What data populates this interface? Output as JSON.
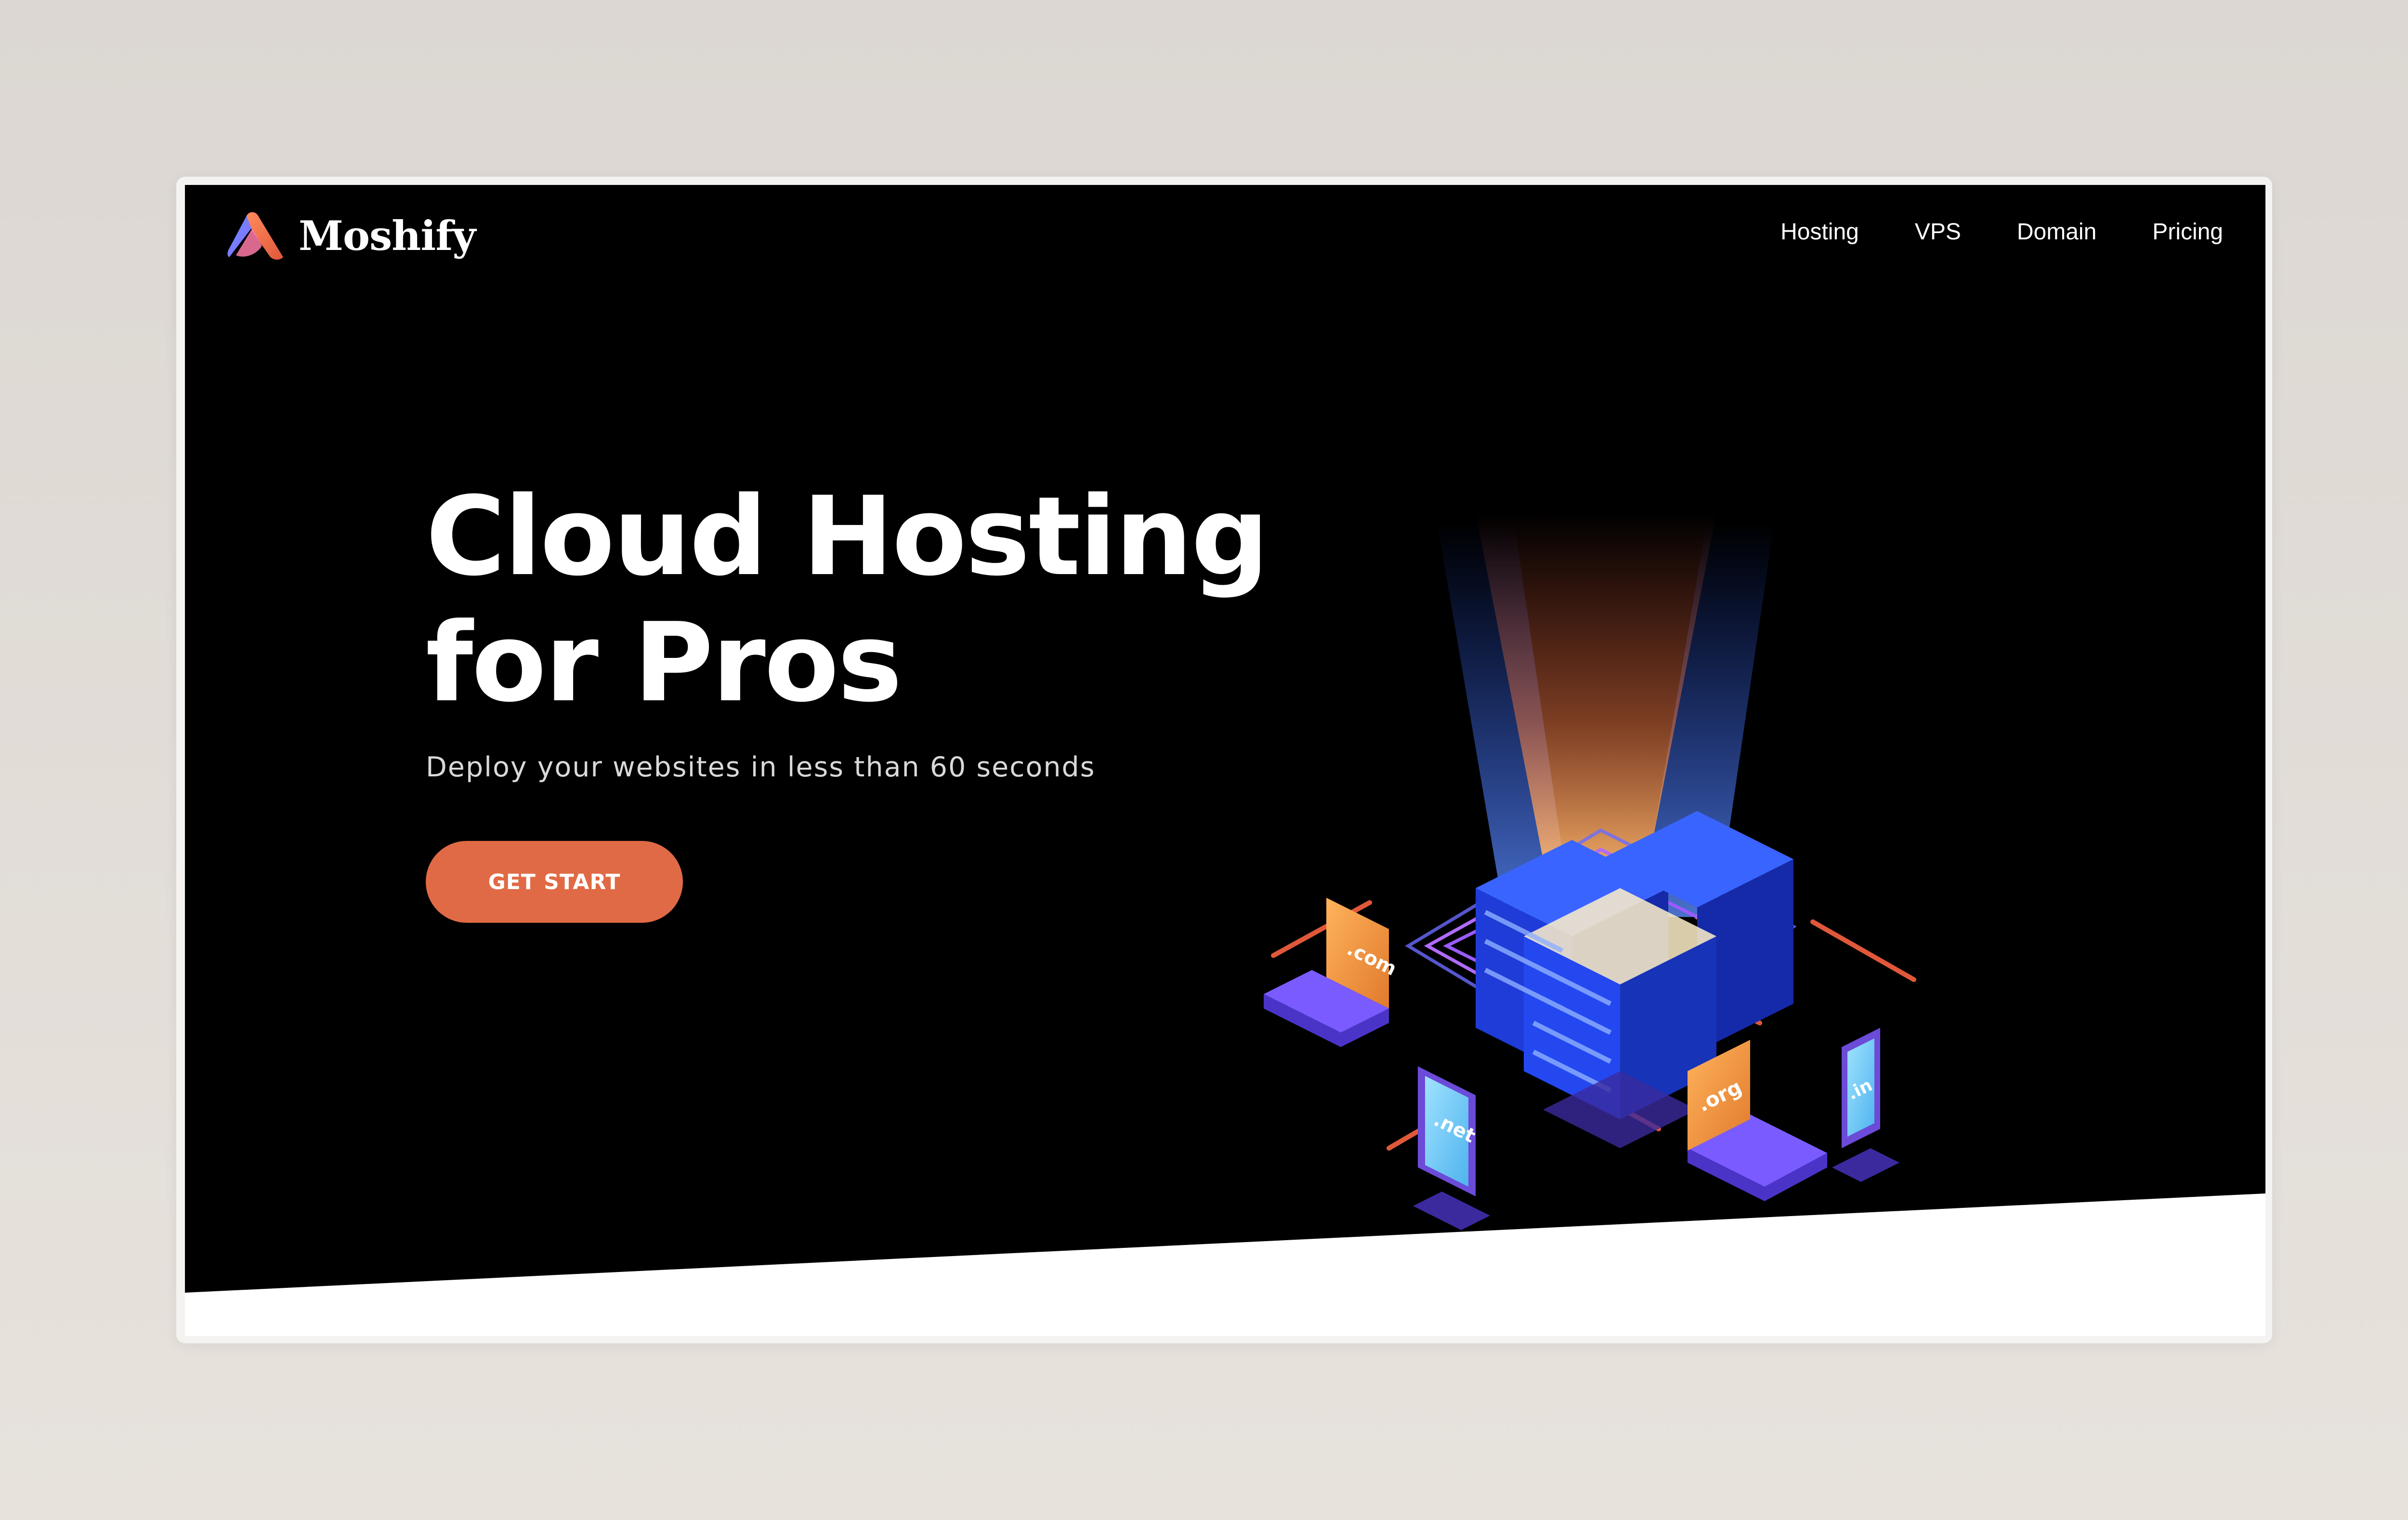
{
  "brand": {
    "name": "Moshify",
    "logo_icon": "moshify-logo-icon"
  },
  "nav": {
    "items": [
      {
        "label": "Hosting"
      },
      {
        "label": "VPS"
      },
      {
        "label": "Domain"
      },
      {
        "label": "Pricing"
      }
    ]
  },
  "hero": {
    "title_line1": "Cloud Hosting",
    "title_line2": "for Pros",
    "subtitle": "Deploy your websites in less than 60 seconds",
    "cta_label": "GET START"
  },
  "illustration": {
    "domains": [
      ".com",
      ".net",
      ".org",
      ".in"
    ]
  },
  "colors": {
    "hero_bg": "#000000",
    "accent": "#e06a45",
    "server_blue": "#2a4bff",
    "device_purple": "#6b4bd8"
  }
}
